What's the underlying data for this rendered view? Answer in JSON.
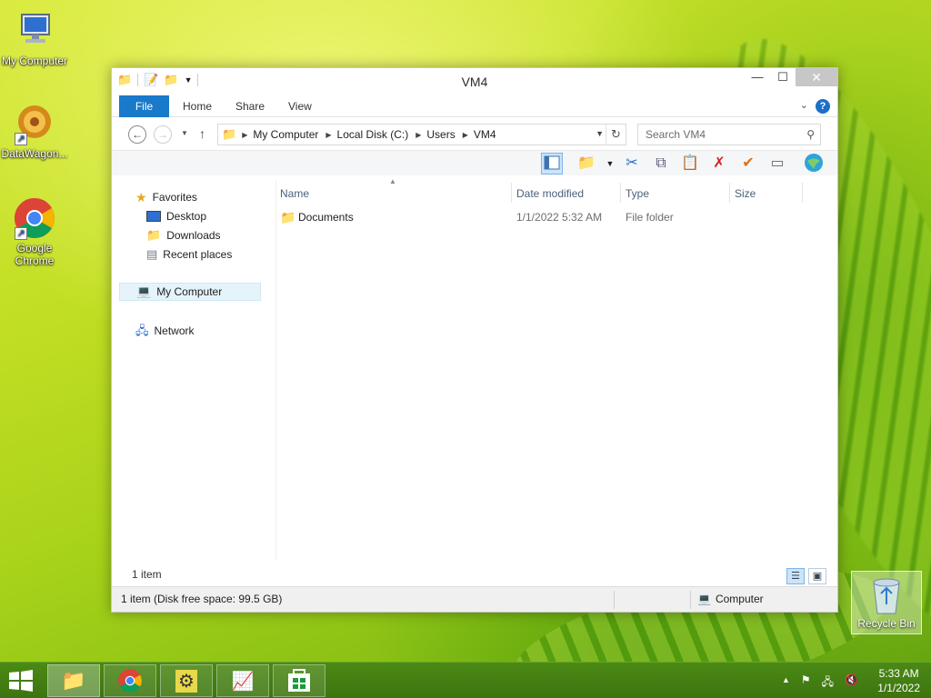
{
  "desktop": {
    "icons": [
      {
        "label": "My Computer"
      },
      {
        "label": "DataWagon..."
      },
      {
        "label": "Google Chrome"
      }
    ],
    "recycle_bin": {
      "label": "Recycle Bin"
    }
  },
  "window": {
    "title": "VM4",
    "ribbon_tabs": [
      "File",
      "Home",
      "Share",
      "View"
    ],
    "nav": {
      "back": "←",
      "forward": "→",
      "up": "↑"
    },
    "address": {
      "crumbs": [
        "My Computer",
        "Local Disk (C:)",
        "Users",
        "VM4"
      ]
    },
    "search": {
      "placeholder": "Search VM4"
    },
    "nav_pane": {
      "favorites": "Favorites",
      "desktop": "Desktop",
      "downloads": "Downloads",
      "recent": "Recent places",
      "computer": "My Computer",
      "network": "Network"
    },
    "columns": [
      "Name",
      "Date modified",
      "Type",
      "Size"
    ],
    "files": [
      {
        "name": "Documents",
        "date": "1/1/2022 5:32 AM",
        "type": "File folder",
        "size": ""
      }
    ],
    "item_count": "1 item",
    "status_left": "1 item (Disk free space: 99.5 GB)",
    "status_right": "Computer"
  },
  "taskbar": {
    "clock_time": "5:33 AM",
    "clock_date": "1/1/2022"
  },
  "colors": {
    "file_tab": "#1979ca",
    "taskbar": "#3d7410"
  }
}
